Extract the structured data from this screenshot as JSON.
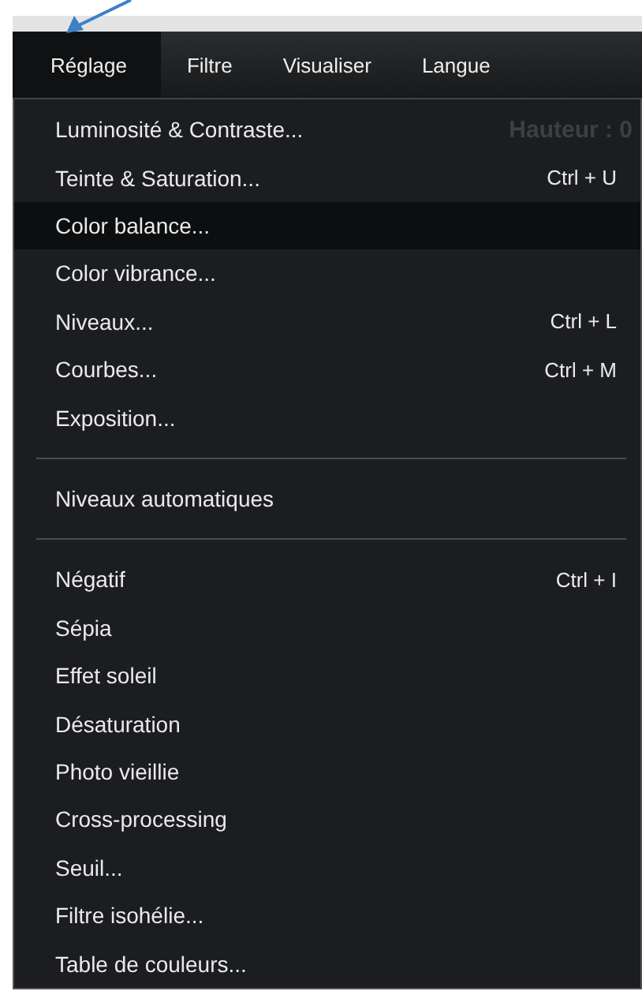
{
  "menubar": [
    {
      "label": "Réglage",
      "selected": true
    },
    {
      "label": "Filtre",
      "selected": false
    },
    {
      "label": "Visualiser",
      "selected": false
    },
    {
      "label": "Langue",
      "selected": false
    }
  ],
  "menu": [
    {
      "kind": "item",
      "label": "Luminosité & Contraste...",
      "behind": "Hauteur : 0",
      "selected": false
    },
    {
      "kind": "item",
      "label": "Teinte & Saturation...",
      "shortcut": "Ctrl + U",
      "selected": false
    },
    {
      "kind": "item",
      "label": "Color balance...",
      "selected": true
    },
    {
      "kind": "item",
      "label": "Color vibrance...",
      "selected": false
    },
    {
      "kind": "item",
      "label": "Niveaux...",
      "shortcut": "Ctrl + L",
      "selected": false
    },
    {
      "kind": "item",
      "label": "Courbes...",
      "shortcut": "Ctrl + M",
      "selected": false
    },
    {
      "kind": "item",
      "label": "Exposition...",
      "selected": false
    },
    {
      "kind": "separator"
    },
    {
      "kind": "item",
      "label": "Niveaux automatiques",
      "selected": false
    },
    {
      "kind": "separator"
    },
    {
      "kind": "item",
      "label": "Négatif",
      "shortcut": "Ctrl + I",
      "selected": false
    },
    {
      "kind": "item",
      "label": "Sépia",
      "selected": false
    },
    {
      "kind": "item",
      "label": "Effet soleil",
      "selected": false
    },
    {
      "kind": "item",
      "label": "Désaturation",
      "selected": false
    },
    {
      "kind": "item",
      "label": "Photo vieillie",
      "selected": false
    },
    {
      "kind": "item",
      "label": "Cross-processing",
      "selected": false
    },
    {
      "kind": "item",
      "label": "Seuil...",
      "selected": false
    },
    {
      "kind": "item",
      "label": "Filtre isohélie...",
      "selected": false
    },
    {
      "kind": "item",
      "label": "Table de couleurs...",
      "selected": false
    }
  ]
}
